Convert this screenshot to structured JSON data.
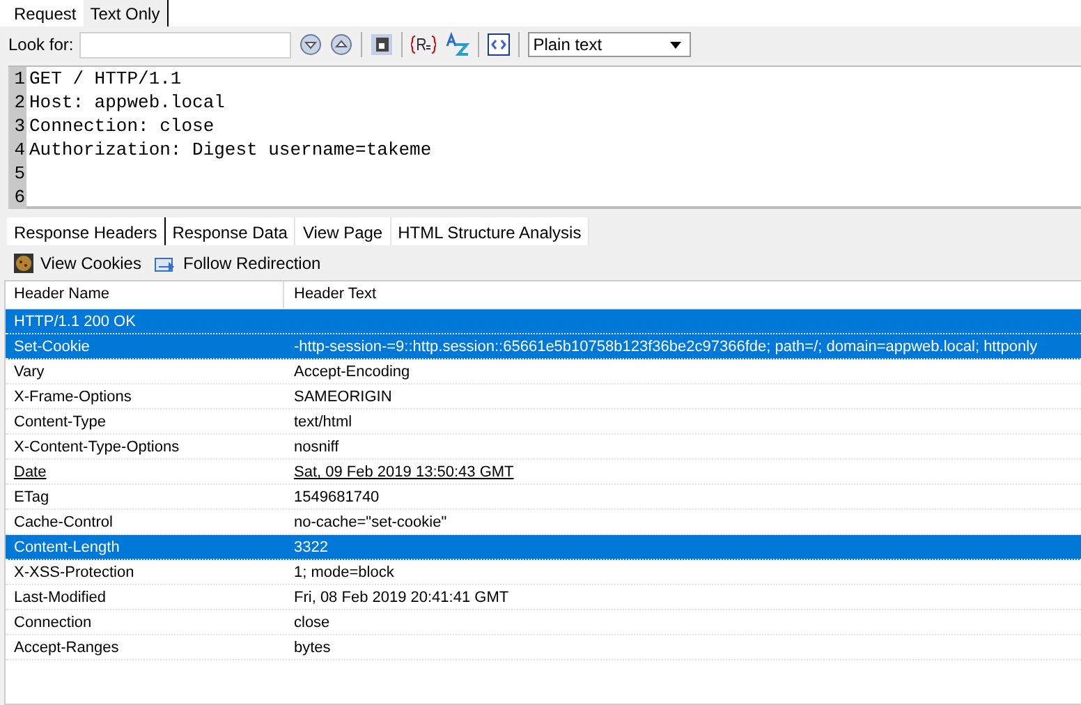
{
  "top_tabs": [
    {
      "label": "Request",
      "selected": false
    },
    {
      "label": "Text Only",
      "selected": true
    }
  ],
  "search": {
    "label": "Look for:"
  },
  "format_select": {
    "value": "Plain text"
  },
  "editor": {
    "lines": [
      {
        "number": "1",
        "text": "GET / HTTP/1.1"
      },
      {
        "number": "2",
        "text": "Host: appweb.local"
      },
      {
        "number": "3",
        "text": "Connection: close"
      },
      {
        "number": "4",
        "text": "Authorization: Digest username=takeme"
      },
      {
        "number": "5"
      },
      {
        "number": "6"
      }
    ]
  },
  "result_tabs": [
    {
      "label": "Response Headers",
      "selected": true
    },
    {
      "label": "Response Data",
      "selected": false
    },
    {
      "label": "View Page",
      "selected": false
    },
    {
      "label": "HTML Structure Analysis",
      "selected": false
    }
  ],
  "toolbar": {
    "view_cookies": "View Cookies",
    "follow_redirection": "Follow Redirection"
  },
  "table": {
    "columns": [
      "Header Name",
      "Header Text"
    ],
    "rows": [
      {
        "name": "HTTP/1.1 200 OK",
        "selected": true,
        "underlined": false
      },
      {
        "name": "Set-Cookie",
        "text": "-http-session-=9::http.session::65661e5b10758b123f36be2c97366fde; path=/; domain=appweb.local; httponly",
        "selected": true,
        "underlined": false
      },
      {
        "name": "Vary",
        "text": "Accept-Encoding",
        "selected": false,
        "underlined": false
      },
      {
        "name": "X-Frame-Options",
        "text": "SAMEORIGIN",
        "selected": false,
        "underlined": false
      },
      {
        "name": "Content-Type",
        "text": "text/html",
        "selected": false,
        "underlined": false
      },
      {
        "name": "X-Content-Type-Options",
        "text": "nosniff",
        "selected": false,
        "underlined": false
      },
      {
        "name": "Date",
        "text": "Sat, 09 Feb 2019 13:50:43 GMT",
        "selected": false,
        "underlined": true
      },
      {
        "name": "ETag",
        "text": "1549681740",
        "selected": false,
        "underlined": false
      },
      {
        "name": "Cache-Control",
        "text": "no-cache=\"set-cookie\"",
        "selected": false,
        "underlined": false
      },
      {
        "name": "Content-Length",
        "text": "3322",
        "selected": true,
        "underlined": false
      },
      {
        "name": "X-XSS-Protection",
        "text": "1; mode=block",
        "selected": false,
        "underlined": false
      },
      {
        "name": "Last-Modified",
        "text": "Fri, 08 Feb 2019 20:41:41 GMT",
        "selected": false,
        "underlined": false
      },
      {
        "name": "Connection",
        "text": "close",
        "selected": false,
        "underlined": false
      },
      {
        "name": "Accept-Ranges",
        "text": "bytes",
        "selected": false,
        "underlined": false
      }
    ]
  }
}
